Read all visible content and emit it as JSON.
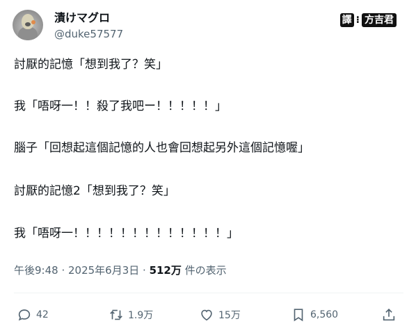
{
  "author": {
    "display_name": "漬けマグロ",
    "handle": "@duke57577"
  },
  "badge": {
    "part1": "譯",
    "part2": "方吉君"
  },
  "tweet_lines": [
    "討厭的記憶「想到我了？笑」",
    "我「唔呀一！！殺了我吧ー！！！！！」",
    "腦子「回想起這個記憶的人也會回想起另外這個記憶喔」",
    "討厭的記憶2「想到我了？笑」",
    "我「唔呀一！！！！！！！！！！！！！」"
  ],
  "meta": {
    "time_date": "午後9:48 · 2025年6月3日 · ",
    "views_count": "512万",
    "views_label": " 件の表示"
  },
  "actions": {
    "reply_count": "42",
    "retweet_count": "1.9万",
    "like_count": "15万",
    "bookmark_count": "6,560"
  },
  "icons": {
    "reply": "reply-icon",
    "retweet": "retweet-icon",
    "like": "heart-icon",
    "bookmark": "bookmark-icon",
    "share": "share-icon"
  }
}
